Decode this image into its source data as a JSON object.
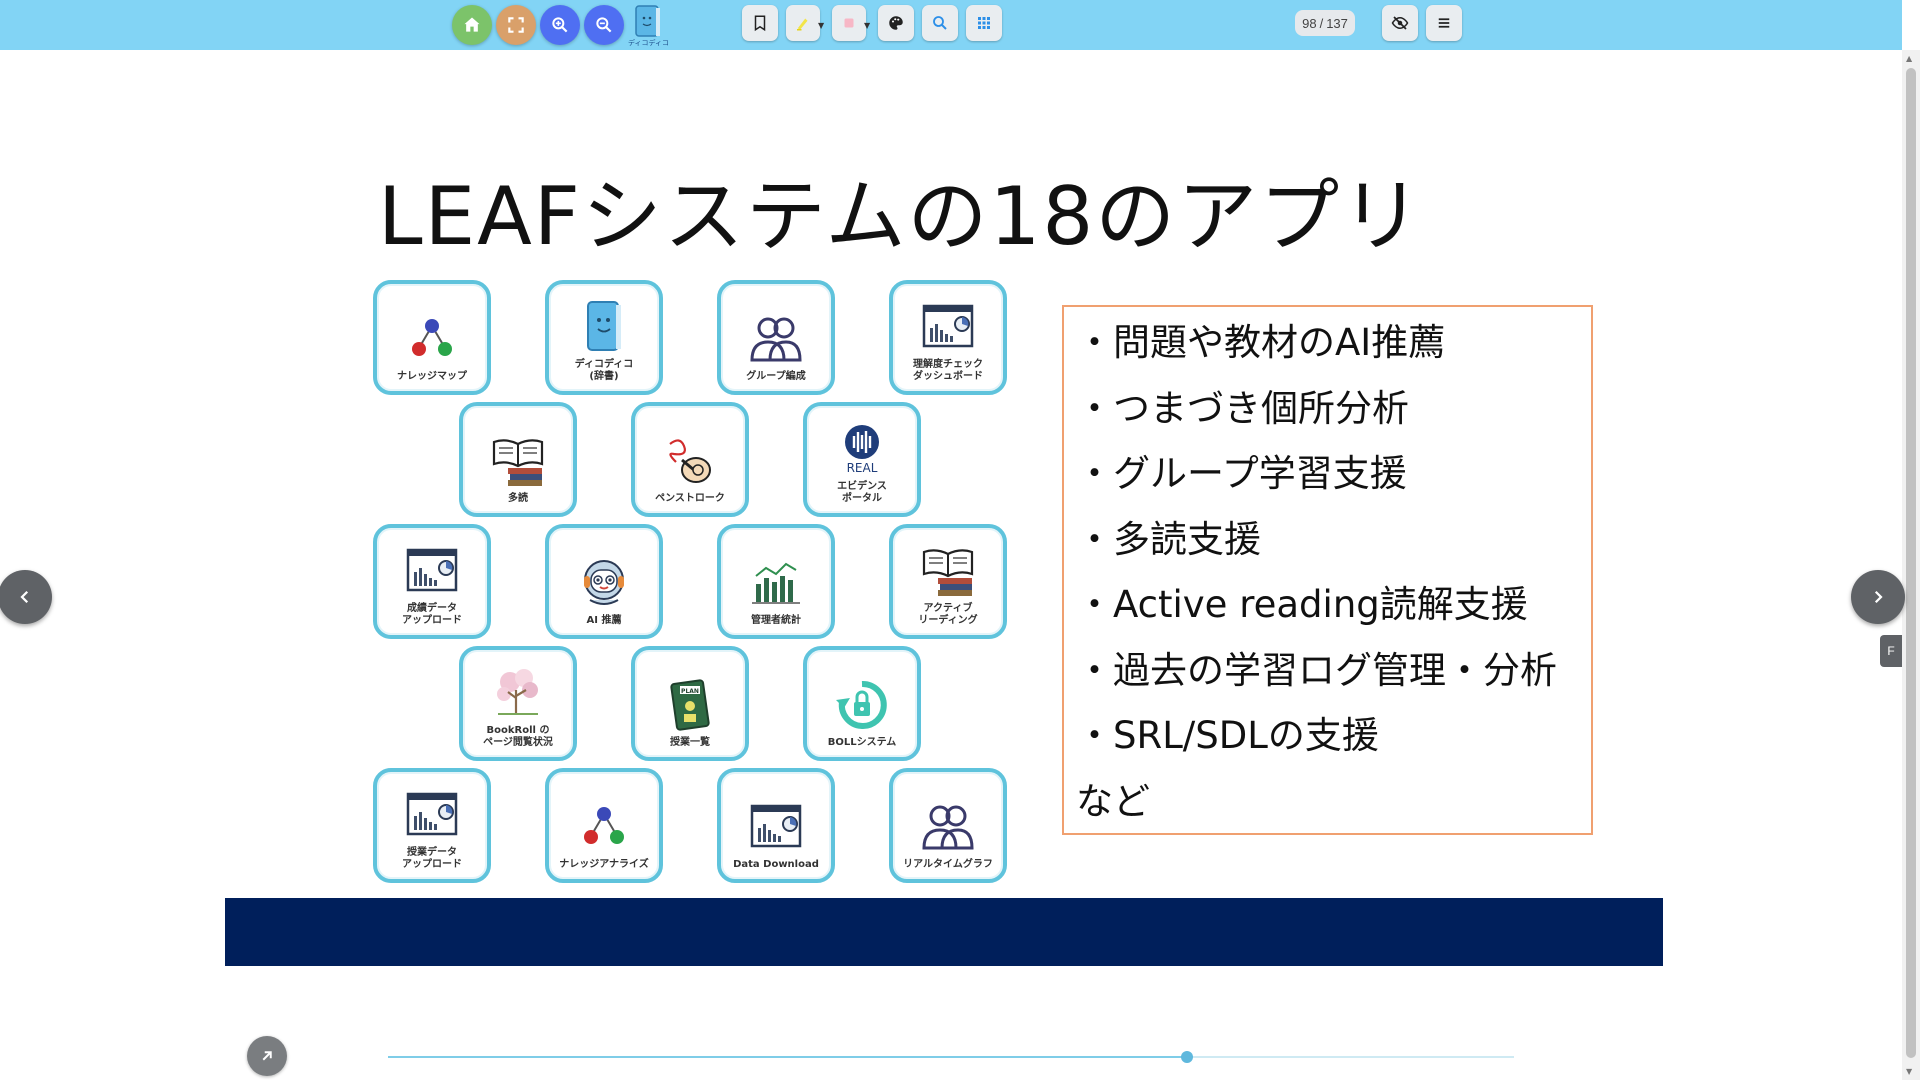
{
  "toolbar": {
    "buttons": [
      {
        "name": "home",
        "icon": "home-icon",
        "color": "#7cc36a"
      },
      {
        "name": "fullscreen",
        "icon": "fullscreen-icon",
        "color": "#d9a06a"
      },
      {
        "name": "zoom-in",
        "icon": "zoom-in-icon",
        "color": "#4f6ff2"
      },
      {
        "name": "zoom-out",
        "icon": "zoom-out-icon",
        "color": "#4f6ff2"
      }
    ],
    "dict_logo_label": "ディコディコ",
    "page_current": "98",
    "page_total": "137",
    "page_separator": "/"
  },
  "slide": {
    "title": "LEAFシステムの18のアプリ",
    "apps": [
      {
        "label": "ナレッジマップ",
        "icon": "knowledge-map-icon"
      },
      {
        "label": "ディコディコ\n(辞書)",
        "icon": "dictionary-book-icon"
      },
      {
        "label": "グループ編成",
        "icon": "group-icon"
      },
      {
        "label": "理解度チェック\nダッシュボード",
        "icon": "dashboard-chart-icon"
      },
      {
        "label": "多読",
        "icon": "books-icon"
      },
      {
        "label": "ペンストローク",
        "icon": "pen-stroke-icon"
      },
      {
        "label": "エビデンス\nポータル",
        "icon": "real-evidence-icon",
        "badge": "REAL"
      },
      {
        "label": "成績データ\nアップロード",
        "icon": "dashboard-chart-icon"
      },
      {
        "label": "AI 推薦",
        "icon": "robot-icon"
      },
      {
        "label": "管理者統計",
        "icon": "bar-stats-icon"
      },
      {
        "label": "アクティブ\nリーディング",
        "icon": "books-icon"
      },
      {
        "label": "BookRoll の\nページ閲覧状況",
        "icon": "tree-icon"
      },
      {
        "label": "授業一覧",
        "icon": "plan-notebook-icon",
        "badge": "PLAN"
      },
      {
        "label": "BOLLシステム",
        "icon": "lock-cycle-icon"
      },
      {
        "label": "授業データ\nアップロード",
        "icon": "dashboard-chart-icon"
      },
      {
        "label": "ナレッジアナライズ",
        "icon": "knowledge-map-icon"
      },
      {
        "label": "Data Download",
        "icon": "dashboard-chart-icon"
      },
      {
        "label": "リアルタイムグラフ",
        "icon": "group-icon"
      }
    ],
    "features": [
      "・問題や教材のAI推薦",
      "・つまづき個所分析",
      "・グループ学習支援",
      "・多読支援",
      "・Active reading読解支援",
      "・過去の学習ログ管理・分析",
      "・SRL/SDLの支援",
      "など"
    ]
  },
  "nav": {
    "side_tab_label": "F"
  },
  "progress": {
    "fraction": 0.71
  },
  "colors": {
    "toolbar_bg": "#82d4f5",
    "tile_border": "#5fc3dc",
    "footer_band": "#001f5b",
    "feature_border": "#f0a070"
  }
}
